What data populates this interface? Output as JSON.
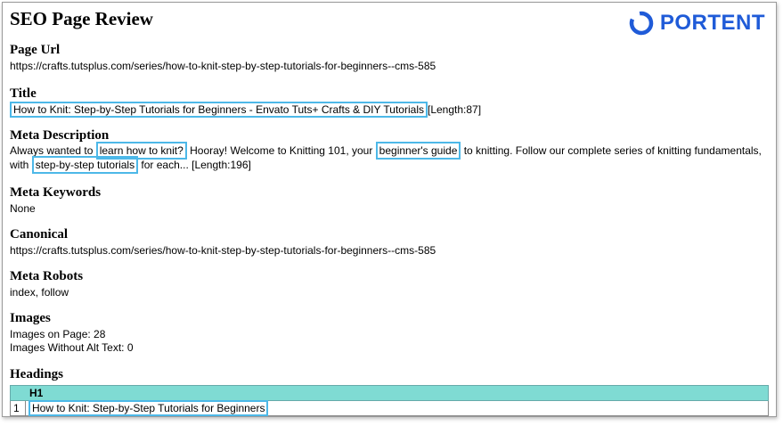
{
  "header": {
    "title": "SEO Page Review",
    "logo_text": "PORTENT",
    "logo_color": "#1f5bd8"
  },
  "page_url": {
    "heading": "Page Url",
    "value": "https://crafts.tutsplus.com/series/how-to-knit-step-by-step-tutorials-for-beginners--cms-585"
  },
  "title_section": {
    "heading": "Title",
    "value": "How to Knit: Step-by-Step Tutorials for Beginners - Envato Tuts+ Crafts & DIY Tutorials",
    "length": "[Length:87]"
  },
  "meta_description": {
    "heading": "Meta Description",
    "part1": "Always wanted to ",
    "hl1": "learn how to knit?",
    "part2": " Hooray! Welcome to Knitting 101, your ",
    "hl2": "beginner's guide",
    "part3": " to knitting. Follow our complete series of knitting fundamentals, with ",
    "hl3": "step-by-step tutorials",
    "part4": " for each... [Length:196]"
  },
  "meta_keywords": {
    "heading": "Meta Keywords",
    "value": "None"
  },
  "canonical": {
    "heading": "Canonical",
    "value": "https://crafts.tutsplus.com/series/how-to-knit-step-by-step-tutorials-for-beginners--cms-585"
  },
  "meta_robots": {
    "heading": "Meta Robots",
    "value": "index, follow"
  },
  "images": {
    "heading": "Images",
    "on_page": "Images on Page: 28",
    "without_alt": "Images Without Alt Text: 0"
  },
  "headings": {
    "heading": "Headings",
    "column": "H1",
    "rows": [
      {
        "num": "1",
        "text": "How to Knit: Step-by-Step Tutorials for Beginners"
      }
    ]
  },
  "colors": {
    "highlight_border": "#4db8e8",
    "table_header": "#7fdbd3"
  }
}
